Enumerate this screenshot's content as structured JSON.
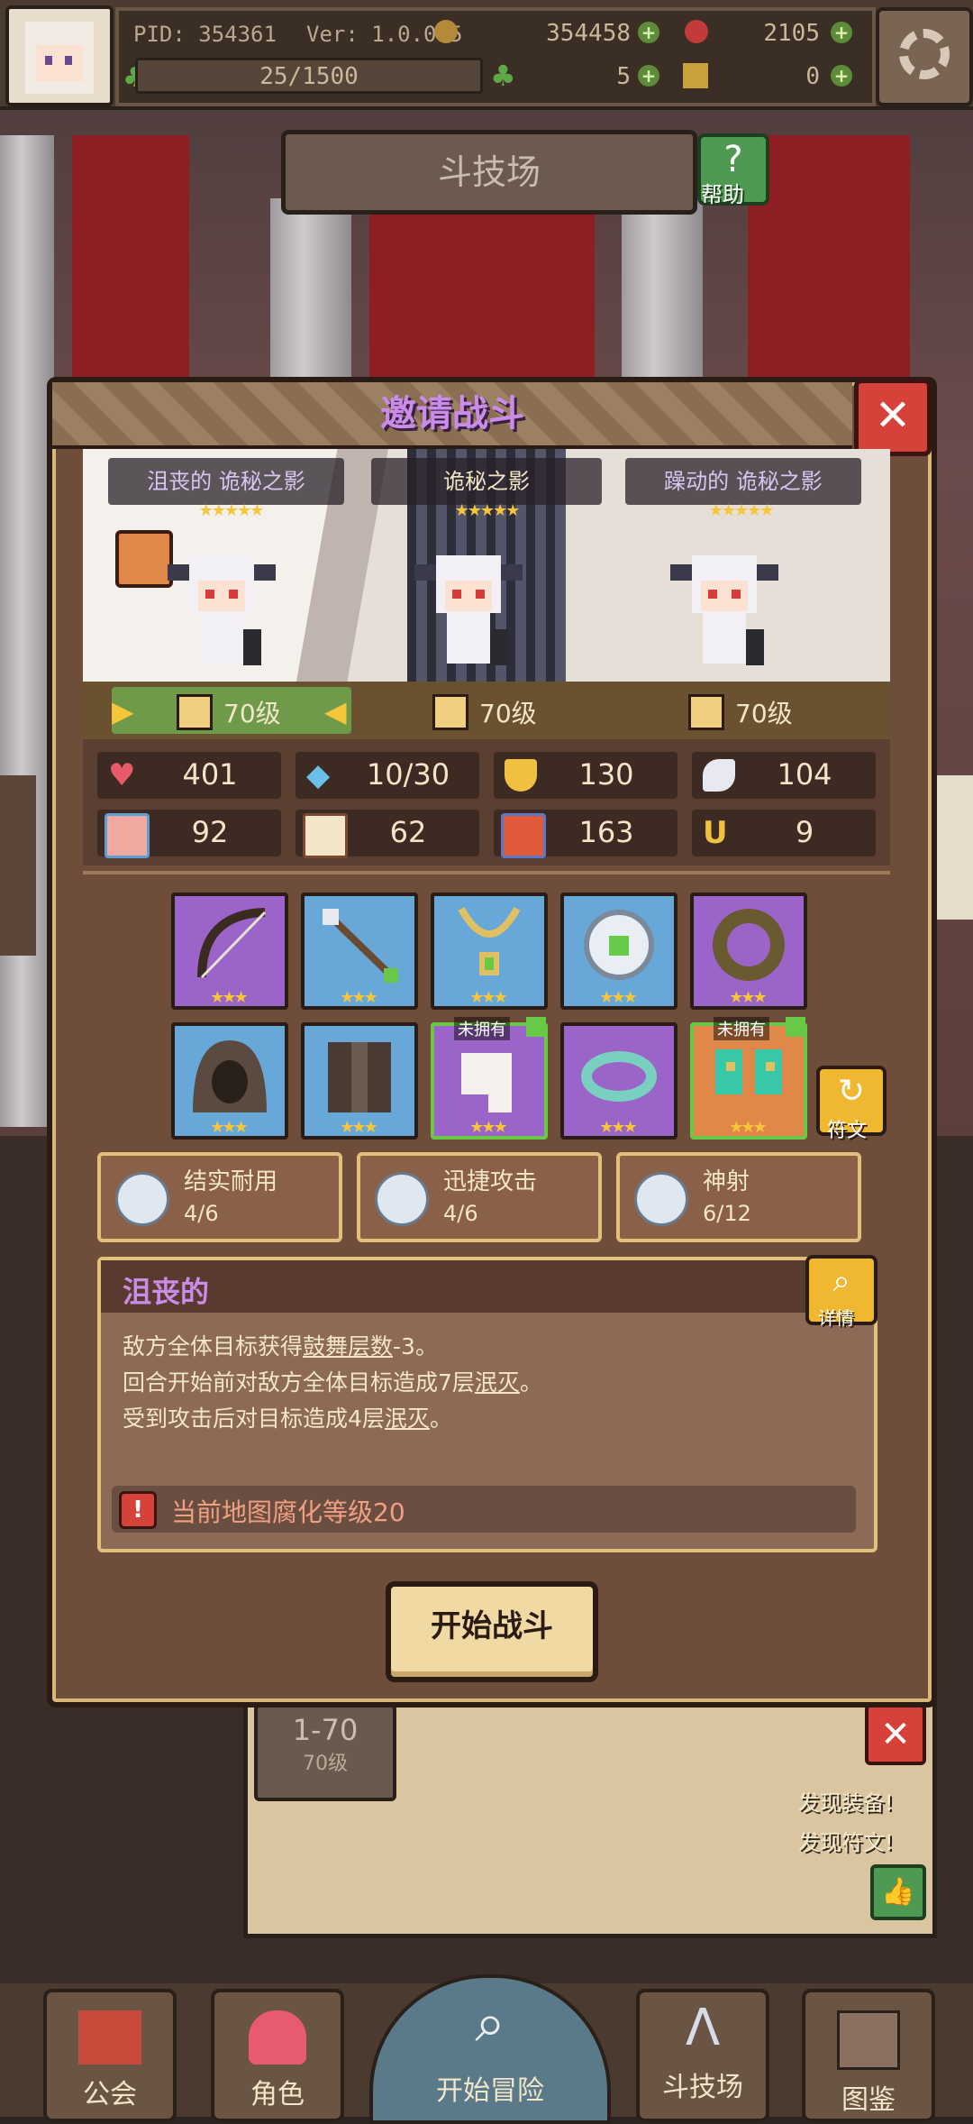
{
  "header": {
    "pid": "PID: 354361",
    "version": "Ver: 1.0.0.5",
    "gold": "354458",
    "gems": "2105",
    "stamina": "25/1500",
    "clover": "5",
    "keys": "0"
  },
  "arena": {
    "title": "斗技场",
    "help_label": "帮助"
  },
  "dialog": {
    "title": "邀请战斗",
    "enemies": [
      {
        "name": "沮丧的 诡秘之影",
        "stars": "★★★★★",
        "level": "70级"
      },
      {
        "name": "诡秘之影",
        "stars": "★★★★★",
        "level": "70级"
      },
      {
        "name": "躁动的 诡秘之影",
        "stars": "★★★★★",
        "level": "70级"
      }
    ],
    "stats": [
      {
        "icon": "heart-icon",
        "value": "401"
      },
      {
        "icon": "water-drop-icon",
        "value": "10/30"
      },
      {
        "icon": "shield-icon",
        "value": "130"
      },
      {
        "icon": "wing-icon",
        "value": "104"
      },
      {
        "icon": "fist-icon",
        "value": "92"
      },
      {
        "icon": "book-icon",
        "value": "62"
      },
      {
        "icon": "flame-card-icon",
        "value": "163"
      },
      {
        "icon": "horseshoe-icon",
        "value": "9"
      }
    ],
    "equipment_row1": [
      {
        "icon": "bow-icon",
        "stars": "★★★"
      },
      {
        "icon": "arrow-icon",
        "stars": "★★★"
      },
      {
        "icon": "necklace-icon",
        "stars": "★★★"
      },
      {
        "icon": "amulet-icon",
        "stars": "★★★"
      },
      {
        "icon": "ring-icon",
        "stars": "★★★"
      }
    ],
    "equipment_row2": [
      {
        "icon": "hood-icon",
        "stars": "★★★",
        "tag": ""
      },
      {
        "icon": "cloak-icon",
        "stars": "★★★",
        "tag": ""
      },
      {
        "icon": "glove-icon",
        "stars": "★★★",
        "tag": "未拥有"
      },
      {
        "icon": "bracelet-icon",
        "stars": "★★★",
        "tag": ""
      },
      {
        "icon": "boots-icon",
        "stars": "★★★",
        "tag": "未拥有"
      }
    ],
    "rune_label": "符文",
    "sets": [
      {
        "name": "结实耐用",
        "count": "4/6"
      },
      {
        "name": "迅捷攻击",
        "count": "4/6"
      },
      {
        "name": "神射",
        "count": "6/12"
      }
    ],
    "trait": {
      "name": "沮丧的",
      "detail_label": "详情",
      "line1_a": "敌方全体目标获得",
      "line1_b": "鼓舞层数",
      "line1_c": "-3。",
      "line2_a": "回合开始前对敌方全体目标造成7层",
      "line2_b": "泯灭",
      "line2_c": "。",
      "line3_a": "受到攻击后对目标造成4层",
      "line3_b": "泯灭",
      "line3_c": "。"
    },
    "warning": "当前地图腐化等级20",
    "start_button": "开始战斗"
  },
  "background": {
    "stage_name": "1-70",
    "stage_level": "70级",
    "found_equipment": "发现装备!",
    "found_rune": "发现符文!"
  },
  "nav": [
    {
      "label": "公会",
      "icon": "guild-icon"
    },
    {
      "label": "角色",
      "icon": "character-icon"
    },
    {
      "label": "开始冒险",
      "icon": "magnifier-icon"
    },
    {
      "label": "斗技场",
      "icon": "arena-icon"
    },
    {
      "label": "图鉴",
      "icon": "codex-icon"
    }
  ]
}
